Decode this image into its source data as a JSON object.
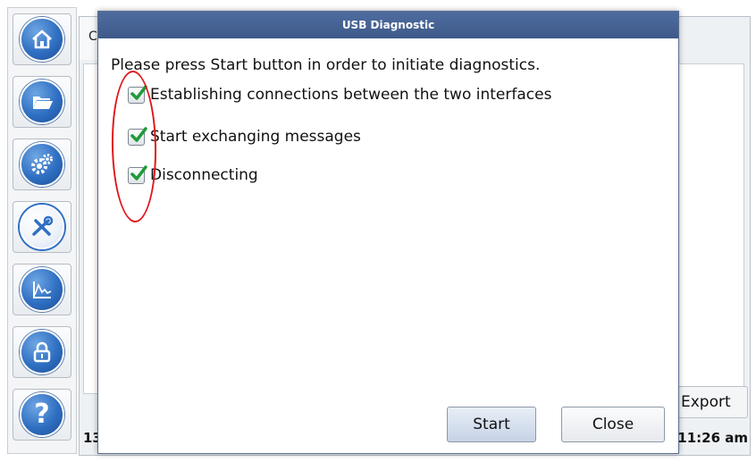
{
  "toolbar": {
    "items": [
      {
        "icon": "home-icon"
      },
      {
        "icon": "folder-icon"
      },
      {
        "icon": "gears-icon"
      },
      {
        "icon": "tools-icon"
      },
      {
        "icon": "chart-icon"
      },
      {
        "icon": "lock-icon"
      },
      {
        "icon": "help-icon"
      }
    ]
  },
  "background": {
    "tab_label": "C",
    "export_label": "Export",
    "status_left": "13",
    "status_time": "11:26 am"
  },
  "dialog": {
    "title": "USB Diagnostic",
    "intro": "Please press Start button in order to initiate diagnostics.",
    "steps": [
      {
        "label": "Establishing connections between the two interfaces",
        "checked": true
      },
      {
        "label": "Start exchanging messages",
        "checked": true
      },
      {
        "label": "Disconnecting",
        "checked": true
      }
    ],
    "start_label": "Start",
    "close_label": "Close"
  },
  "colors": {
    "title_bar": "#4a6698",
    "check": "#1e9a3a",
    "annotation": "#e0161b",
    "icon_blue": "#2f6fc2"
  }
}
